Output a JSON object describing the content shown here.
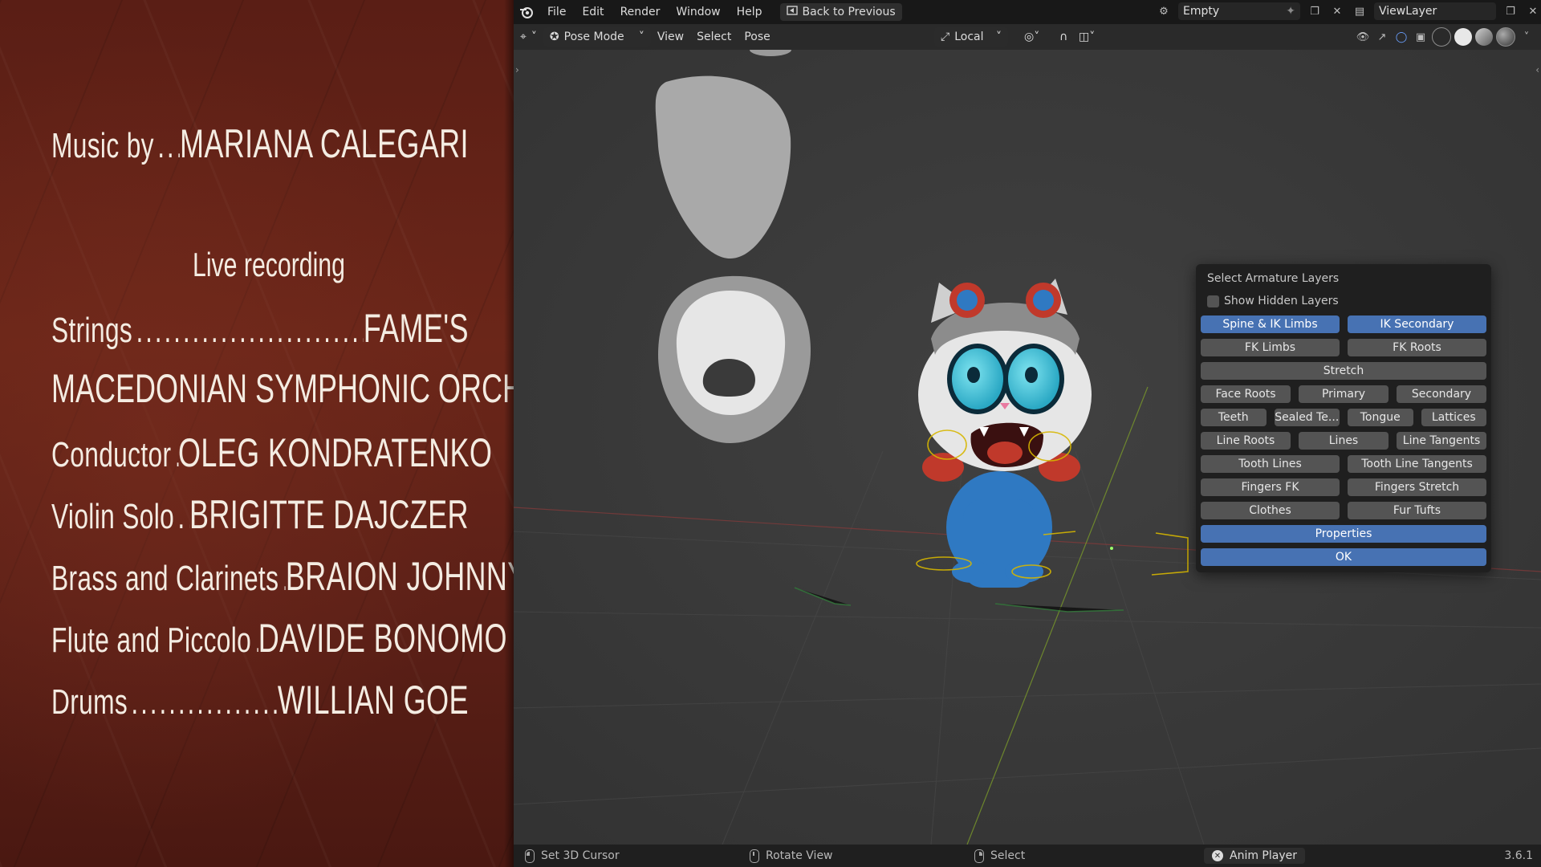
{
  "credits": {
    "music_role": "Music by",
    "music_name": "MARIANA CALEGARI",
    "live_recording": "Live recording",
    "strings_role": "Strings",
    "strings_name": "FAME'S",
    "orchestra": "MACEDONIAN SYMPHONIC ORCHESTRA",
    "conductor_role": "Conductor",
    "conductor_name": "OLEG KONDRATENKO",
    "violin_role": "Violin Solo",
    "violin_name": "BRIGITTE DAJCZER",
    "brass_role": "Brass and Clarinets",
    "brass_name": "BRAION JOHNNY",
    "flute_role": "Flute and Piccolo",
    "flute_name": "DAVIDE BONOMO",
    "drums_role": "Drums",
    "drums_name": "WILLIAN GOE",
    "dots_short": "..........",
    "dots_long": "..............................."
  },
  "topbar": {
    "menus": [
      "File",
      "Edit",
      "Render",
      "Window",
      "Help"
    ],
    "back_label": "Back to Previous",
    "scene_name": "Empty",
    "view_layer": "ViewLayer"
  },
  "header": {
    "mode": "Pose Mode",
    "menus": [
      "View",
      "Select",
      "Pose"
    ],
    "pivot": "Local"
  },
  "popup": {
    "title": "Select Armature Layers",
    "show_hidden": "Show Hidden Layers",
    "rows": [
      [
        "Spine & IK Limbs",
        "IK Secondary"
      ],
      [
        "FK Limbs",
        "FK Roots"
      ],
      [
        "Stretch"
      ],
      [
        "Face Roots",
        "Primary",
        "Secondary"
      ],
      [
        "Teeth",
        "Sealed Te...",
        "Tongue",
        "Lattices"
      ],
      [
        "Line Roots",
        "Lines",
        "Line Tangents"
      ],
      [
        "Tooth Lines",
        "Tooth Line Tangents"
      ],
      [
        "Fingers FK",
        "Fingers Stretch"
      ],
      [
        "Clothes",
        "Fur Tufts"
      ],
      [
        "Properties"
      ],
      [
        "OK"
      ]
    ],
    "active": [
      "Spine & IK Limbs",
      "IK Secondary",
      "Properties",
      "OK"
    ]
  },
  "status": {
    "left": "Set 3D Cursor",
    "middle": "Rotate View",
    "right": "Select",
    "anim_player": "Anim Player",
    "version": "3.6.1"
  },
  "colors": {
    "accent": "#4772b3",
    "wood": "#5e2117"
  }
}
